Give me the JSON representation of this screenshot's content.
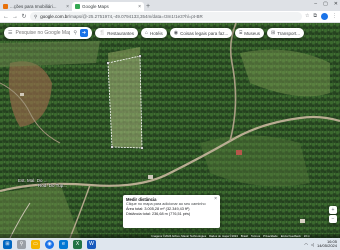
{
  "browser": {
    "tabs": [
      {
        "label": "...ções para Imobiliári...",
        "active": false
      },
      {
        "label": "Google Maps",
        "active": true
      }
    ],
    "url_domain": "google.com.br",
    "url_path": "/maps/@-25.2751974,-49.0794133,354m/data=!3m1!1e3?hl=pt-BR"
  },
  "maps": {
    "search_placeholder": "Pesquise no Google Maps",
    "chips": [
      {
        "icon": "restaurant-icon",
        "label": "Restaurantes"
      },
      {
        "icon": "hotel-icon",
        "label": "Hotéis"
      },
      {
        "icon": "camera-icon",
        "label": "Coisas legais para faz..."
      },
      {
        "icon": "museum-icon",
        "label": "Museus"
      },
      {
        "icon": "transit-icon",
        "label": "Transport..."
      }
    ],
    "road_label_1": "Est. Mal. Do ...",
    "road_label_2": "Rod. Do Tup...",
    "measure": {
      "title": "Medir distância",
      "hint": "Clique no mapa para adicionar ao seu caminho",
      "area": "Área total: 3.005,28 m² (32.349,43 ft²)",
      "distance": "Distância total: 236,68 m (776,51 pés)"
    },
    "footer": [
      "Imagens ©2024 Airbus, Maxar Technologies",
      "Dados do mapa ©2024",
      "Brasil",
      "Termos",
      "Privacidade",
      "Enviar feedback",
      "20 m"
    ]
  },
  "taskbar": {
    "time": "16:05",
    "date": "14/05/2024"
  },
  "colors": {
    "google_blue": "#1a73e8",
    "forest": "#2c4d26"
  }
}
